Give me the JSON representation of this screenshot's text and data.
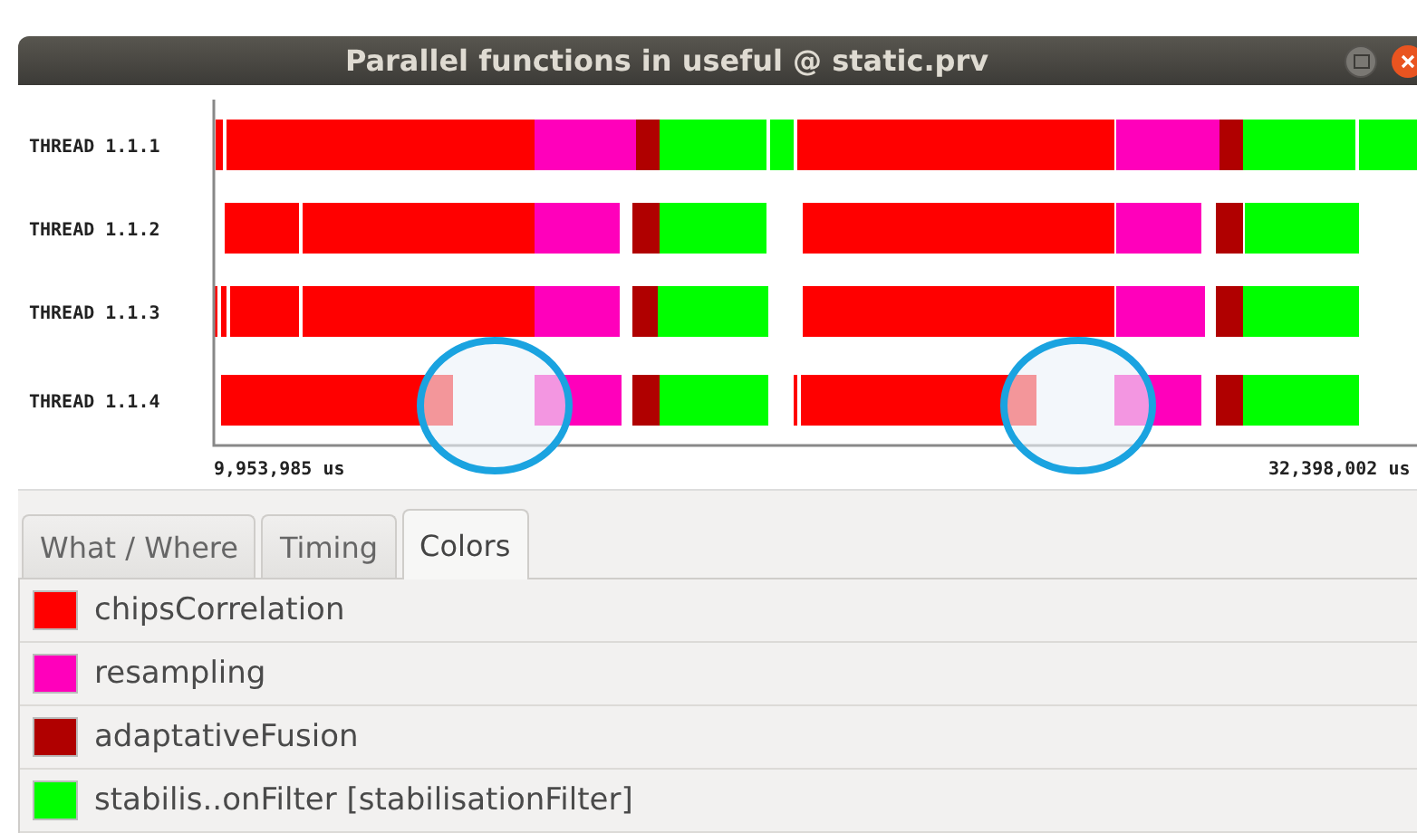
{
  "window": {
    "title": "Parallel functions in useful @ static.prv"
  },
  "timeline": {
    "threads": [
      {
        "label": "THREAD 1.1.1"
      },
      {
        "label": "THREAD 1.1.2"
      },
      {
        "label": "THREAD 1.1.3"
      },
      {
        "label": "THREAD 1.1.4"
      }
    ],
    "start_time": "9,953,985 us",
    "end_time": "32,398,002 us"
  },
  "tabs": [
    {
      "label": "What / Where",
      "selected": false
    },
    {
      "label": "Timing",
      "selected": false
    },
    {
      "label": "Colors",
      "selected": true
    }
  ],
  "legend": [
    {
      "name": "chipsCorrelation",
      "color": "#ff0000"
    },
    {
      "name": "resampling",
      "color": "#ff00bb"
    },
    {
      "name": "adaptativeFusion",
      "color": "#b00000"
    },
    {
      "name": "stabilis..onFilter [stabilisationFilter]",
      "color": "#00ff00"
    }
  ]
}
